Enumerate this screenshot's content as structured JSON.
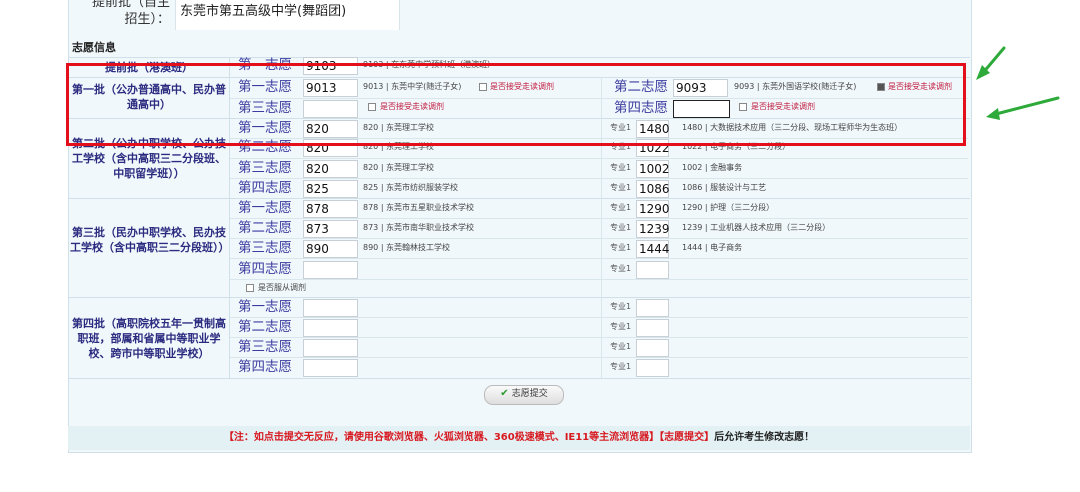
{
  "header": {
    "label": "提前批（自主招生）：",
    "value": "东莞市第五高级中学(舞蹈团)"
  },
  "section_title": "志愿信息",
  "batches": [
    {
      "label": "提前批（港澳班）",
      "rows": [
        {
          "pref": "第一志愿",
          "code": "9103",
          "desc": "9103 | 在东莞中学预科班（港澳班）"
        }
      ]
    },
    {
      "label": "第一批（公办普通高中、民办普通高中）",
      "rows": [
        {
          "pref": "第一志愿",
          "code": "9013",
          "desc": "9013 | 东莞中学(随迁子女)",
          "cb_label": "是否接受走读调剂",
          "cb_checked": false,
          "pref2": "第二志愿",
          "code2": "9093",
          "desc2": "9093 | 东莞外国语学校(随迁子女)",
          "cb2_label": "是否接受走读调剂",
          "cb2_checked": true
        },
        {
          "pref": "第三志愿",
          "code": "",
          "desc": "",
          "cb_label": "是否接受走读调剂",
          "cb_checked": false,
          "pref2": "第四志愿",
          "code2": "",
          "desc2": "",
          "cb2_label": "是否接受走读调剂",
          "cb2_checked": false
        }
      ]
    },
    {
      "label": "第二批（公办中职学校、公办技工学校（含中高职三二分段班、中职留学班））",
      "rows": [
        {
          "pref": "第一志愿",
          "code": "820",
          "desc": "820 | 东莞理工学校",
          "major_label": "专业1",
          "major_code": "1480",
          "major_desc": "1480 | 大数据技术应用（三二分段、现场工程师华为生态班）"
        },
        {
          "pref": "第二志愿",
          "code": "820",
          "desc": "820 | 东莞理工学校",
          "major_label": "专业1",
          "major_code": "1022",
          "major_desc": "1022 | 电子商务（三二分段）"
        },
        {
          "pref": "第三志愿",
          "code": "820",
          "desc": "820 | 东莞理工学校",
          "major_label": "专业1",
          "major_code": "1002",
          "major_desc": "1002 | 金融事务"
        },
        {
          "pref": "第四志愿",
          "code": "825",
          "desc": "825 | 东莞市纺织服装学校",
          "major_label": "专业1",
          "major_code": "1086",
          "major_desc": "1086 | 服装设计与工艺"
        }
      ]
    },
    {
      "label": "第三批（民办中职学校、民办技工学校（含中高职三二分段班））",
      "rows": [
        {
          "pref": "第一志愿",
          "code": "878",
          "desc": "878 | 东莞市五星职业技术学校",
          "major_label": "专业1",
          "major_code": "1290",
          "major_desc": "1290 | 护理（三二分段）"
        },
        {
          "pref": "第二志愿",
          "code": "873",
          "desc": "873 | 东莞市南华职业技术学校",
          "major_label": "专业1",
          "major_code": "1239",
          "major_desc": "1239 | 工业机器人技术应用（三二分段）"
        },
        {
          "pref": "第三志愿",
          "code": "890",
          "desc": "890 | 东莞翰林技工学校",
          "major_label": "专业1",
          "major_code": "1444",
          "major_desc": "1444 | 电子商务"
        },
        {
          "pref": "第四志愿",
          "code": "",
          "desc": "",
          "major_label": "专业1",
          "major_code": "",
          "major_desc": ""
        }
      ],
      "obey_label": "是否服从调剂"
    },
    {
      "label": "第四批（高职院校五年一贯制高职班，部属和省属中等职业学校、跨市中等职业学校）",
      "rows": [
        {
          "pref": "第一志愿",
          "code": "",
          "desc": "",
          "major_label": "专业1",
          "major_code": "",
          "major_desc": ""
        },
        {
          "pref": "第二志愿",
          "code": "",
          "desc": "",
          "major_label": "专业1",
          "major_code": "",
          "major_desc": ""
        },
        {
          "pref": "第三志愿",
          "code": "",
          "desc": "",
          "major_label": "专业1",
          "major_code": "",
          "major_desc": ""
        },
        {
          "pref": "第四志愿",
          "code": "",
          "desc": "",
          "major_label": "专业1",
          "major_code": "",
          "major_desc": ""
        }
      ]
    }
  ],
  "submit_label": "志愿提交",
  "note": {
    "red": "【注：如点击提交无反应，请使用谷歌浏览器、火狐浏览器、360极速模式、IE11等主流浏览器】【志愿提交】",
    "black": "后允许考生修改志愿！"
  },
  "colors": {
    "highlight_box": "#e3101c",
    "arrow": "#2eaa3a",
    "label_blue": "#3c3ca0",
    "batch_text": "#2b2b80"
  }
}
